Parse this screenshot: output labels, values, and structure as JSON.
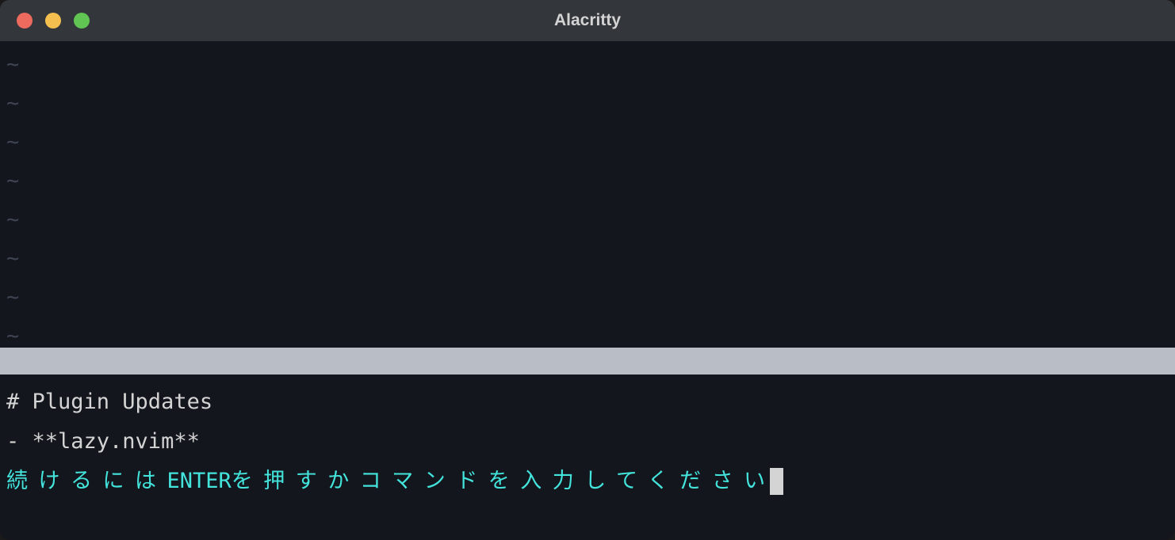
{
  "window": {
    "title": "Alacritty"
  },
  "buffer": {
    "tilde_count": 8,
    "tilde": "~"
  },
  "messages": {
    "header": "# Plugin Updates",
    "item": "- **lazy.nvim**",
    "prompt_prefix_cjk": "続けるには",
    "prompt_enter": "ENTER",
    "prompt_suffix_cjk": "を押すかコマンドを入力してください"
  }
}
